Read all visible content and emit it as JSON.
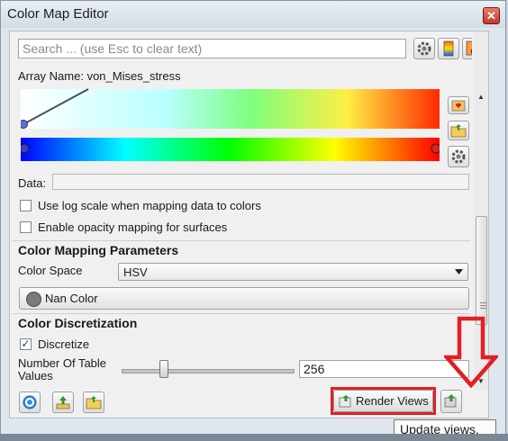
{
  "window": {
    "title": "Color Map Editor",
    "close_glyph": "✕"
  },
  "search": {
    "placeholder": "Search ... (use Esc to clear text)",
    "value": ""
  },
  "array_name": "Array Name: von_Mises_stress",
  "data_label": "Data:",
  "data_value": "",
  "checkboxes": {
    "log_scale": {
      "label": "Use log scale when mapping data to colors",
      "checked": false
    },
    "opacity": {
      "label": "Enable opacity mapping for surfaces",
      "checked": false
    }
  },
  "color_mapping": {
    "heading": "Color Mapping Parameters",
    "color_space_label": "Color Space",
    "color_space_value": "HSV",
    "nan_color_label": "Nan Color"
  },
  "discretization": {
    "heading": "Color Discretization",
    "discretize_label": "Discretize",
    "discretize_checked": true,
    "table_values_label_line1": "Number Of Table",
    "table_values_label_line2": "Values",
    "table_values_value": "256",
    "slider_fraction": 0.22
  },
  "buttons": {
    "render_views": "Render Views"
  },
  "tooltip": "Update views.",
  "icons": [
    "gear-icon",
    "color-palette-icon",
    "save-palette-icon",
    "favorite-preset-icon",
    "import-preset-icon",
    "advanced-gear-icon",
    "rescale-range-icon",
    "reset-range-icon",
    "folder-icon",
    "render-views-icon",
    "auto-update-icon"
  ],
  "colors": {
    "highlight_red": "#e41e26",
    "hsv_gradient": [
      "#0000ff",
      "#00ffff",
      "#00ff00",
      "#ffff00",
      "#ff0000"
    ],
    "opacity_gradient": [
      "#ffffff",
      "#00ffff",
      "#00ff00",
      "#ffff00",
      "#ff0000"
    ]
  }
}
